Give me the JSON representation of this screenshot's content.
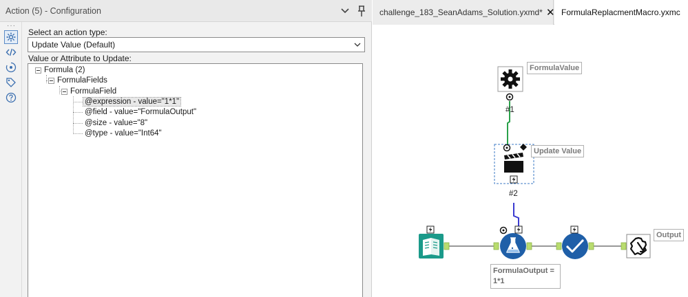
{
  "panel": {
    "title": "Action (5) - Configuration",
    "action_type_label": "Select an action type:",
    "action_type_value": "Update Value (Default)",
    "value_attr_label": "Value or Attribute to Update:"
  },
  "tree": {
    "formula": "Formula (2)",
    "formula_fields": "FormulaFields",
    "formula_field": "FormulaField",
    "attributes": [
      "@expression - value=\"1*1\"",
      "@field - value=\"FormulaOutput\"",
      "@size - value=\"8\"",
      "@type - value=\"Int64\""
    ]
  },
  "tabs": [
    {
      "label": "challenge_183_SeanAdams_Solution.yxmd*",
      "close": "✕"
    },
    {
      "label": "FormulaReplacmentMacro.yxmc"
    }
  ],
  "canvas": {
    "formula_value_label": "FormulaValue",
    "update_value_label": "Update Value",
    "output_label": "Output",
    "conn_1": "#1",
    "conn_2": "#2",
    "annotation": "FormulaOutput = 1*1"
  },
  "colors": {
    "accent_blue": "#1f5fa8",
    "connection_green": "#2aa14a",
    "connection_blue": "#3a3ad0",
    "teal_input": "#1b9a8a",
    "anchor_green": "#b9dc6e"
  }
}
